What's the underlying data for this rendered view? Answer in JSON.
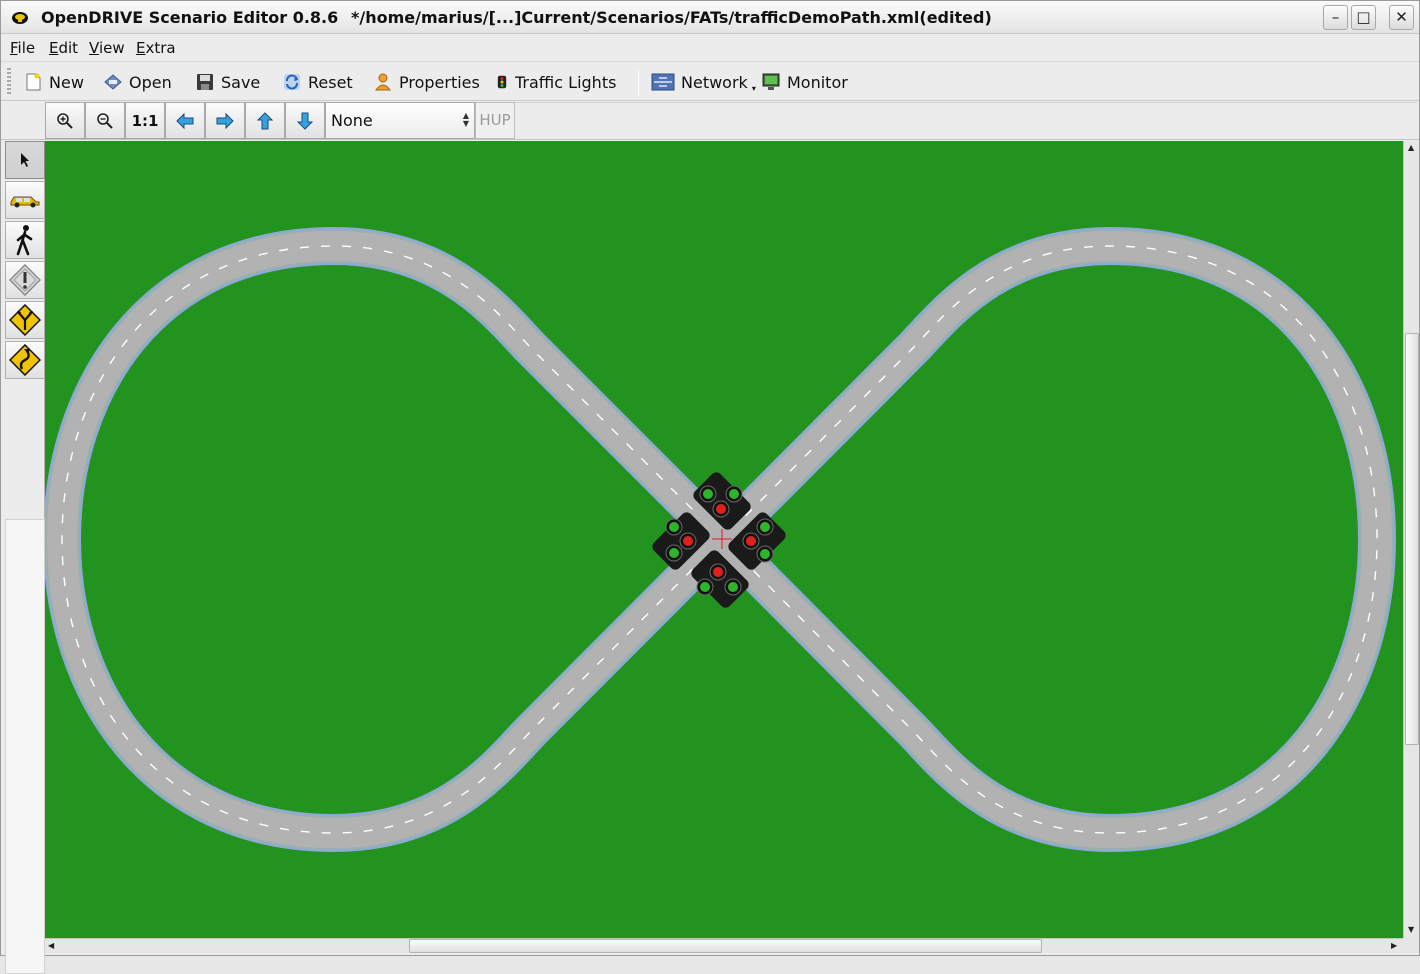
{
  "window": {
    "title": "OpenDRIVE Scenario Editor 0.8.6",
    "document": "*/home/marius/[...]Current/Scenarios/FATs/trafficDemoPath.xml(edited)",
    "minimize_glyph": "–",
    "maximize_glyph": "□",
    "close_glyph": "✕"
  },
  "menu": {
    "file": {
      "accel": "F",
      "rest": "ile"
    },
    "edit": {
      "accel": "E",
      "rest": "dit"
    },
    "view": {
      "accel": "V",
      "rest": "iew"
    },
    "extra": {
      "accel": "E",
      "rest": "xtra"
    }
  },
  "toolbar": {
    "new_label": "New",
    "open_label": "Open",
    "save_label": "Save",
    "reset_label": "Reset",
    "properties_label": "Properties",
    "traffic_lights_label": "Traffic Lights",
    "network_label": "Network",
    "monitor_label": "Monitor"
  },
  "viewbar": {
    "zoom_in_icon": "zoom-in-icon",
    "zoom_out_icon": "zoom-out-icon",
    "one_to_one_label": "1:1",
    "combo_value": "None",
    "hup_label": "HUP"
  },
  "palette": {
    "tools": [
      "select-tool",
      "vehicle-tool",
      "pedestrian-tool",
      "warning-sign-tool",
      "junction-sign-tool",
      "curve-sign-tool"
    ]
  },
  "colors": {
    "grass": "#22931f",
    "road": "#b2b2b2",
    "road_edge": "#8fa8d8",
    "lane_mark": "#ffffff",
    "signal_red": "#e0201c",
    "signal_green": "#2fb52b"
  }
}
